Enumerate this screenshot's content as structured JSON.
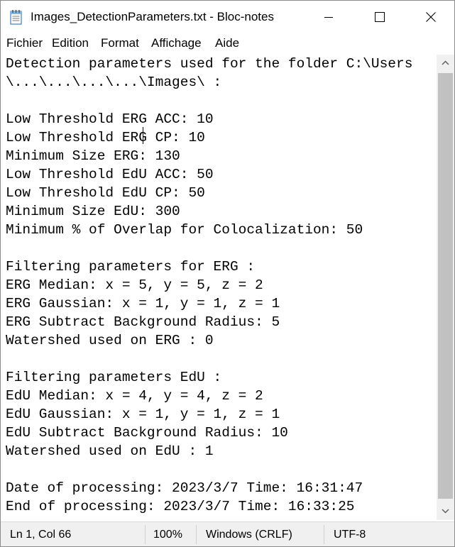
{
  "window": {
    "title": "Images_DetectionParameters.txt - Bloc-notes",
    "app_icon": "notepad-icon"
  },
  "menu": [
    "Fichier",
    "Edition",
    "Format",
    "Affichage",
    "Aide"
  ],
  "editor": {
    "lines": [
      "Detection parameters used for the folder C:\\Users",
      "\\...\\...\\...\\...\\Images\\ :",
      "",
      "Low Threshold ERG ACC: 10",
      "Low Threshold ERG CP: 10",
      "Minimum Size ERG: 130",
      "Low Threshold EdU ACC: 50",
      "Low Threshold EdU CP: 50",
      "Minimum Size EdU: 300",
      "Minimum % of Overlap for Colocalization: 50",
      "",
      "Filtering parameters for ERG :",
      "ERG Median: x = 5, y = 5, z = 2",
      "ERG Gaussian: x = 1, y = 1, z = 1",
      "ERG Subtract Background Radius: 5",
      "Watershed used on ERG : 0",
      "",
      "Filtering parameters EdU :",
      "EdU Median: x = 4, y = 4, z = 2",
      "EdU Gaussian: x = 1, y = 1, z = 1",
      "EdU Subtract Background Radius: 10",
      "Watershed used on EdU : 1",
      "",
      "Date of processing: 2023/3/7 Time: 16:31:47",
      "End of processing: 2023/3/7 Time: 16:33:25"
    ]
  },
  "status": {
    "position": "Ln 1, Col 66",
    "zoom": "100%",
    "line_endings": "Windows (CRLF)",
    "encoding": "UTF-8"
  }
}
